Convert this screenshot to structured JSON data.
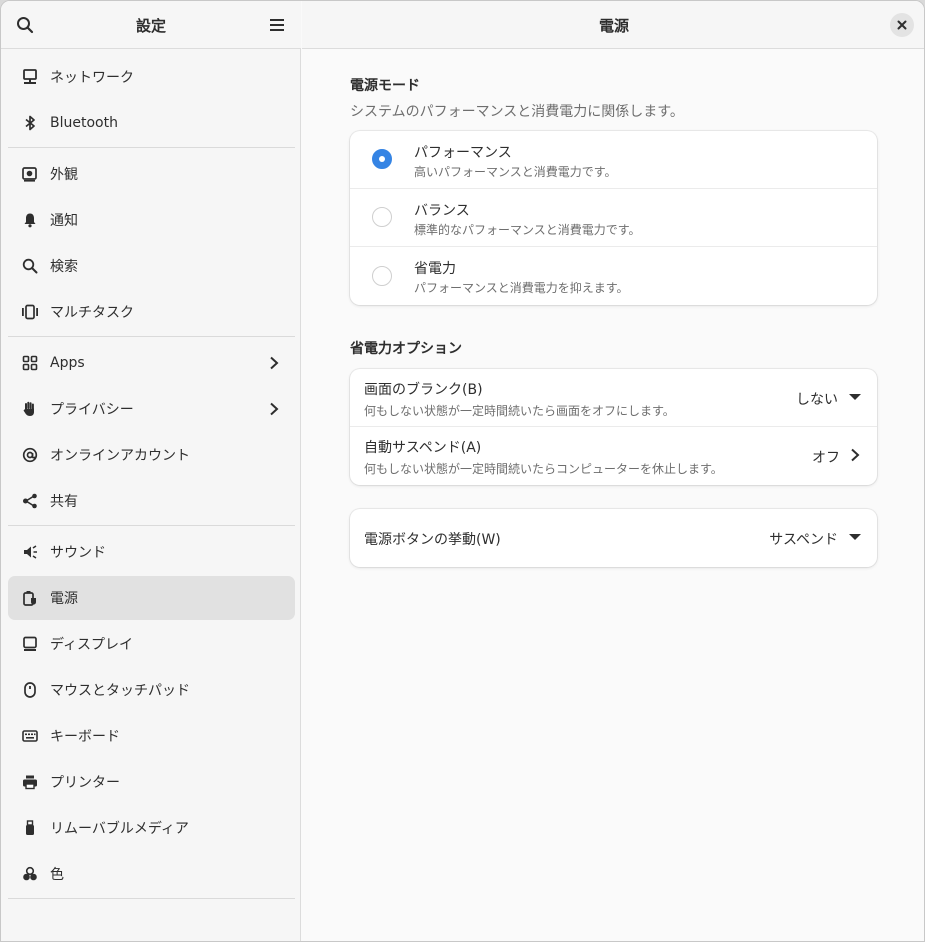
{
  "sidebar": {
    "title": "設定",
    "items": [
      {
        "label": "ネットワーク",
        "icon": "network-wired-icon"
      },
      {
        "label": "Bluetooth",
        "icon": "bluetooth-icon"
      },
      {
        "label": "外観",
        "icon": "appearance-icon"
      },
      {
        "label": "通知",
        "icon": "bell-icon"
      },
      {
        "label": "検索",
        "icon": "search-icon"
      },
      {
        "label": "マルチタスク",
        "icon": "multitasking-icon"
      },
      {
        "label": "Apps",
        "icon": "apps-grid-icon",
        "has_chevron": true
      },
      {
        "label": "プライバシー",
        "icon": "hand-icon",
        "has_chevron": true
      },
      {
        "label": "オンラインアカウント",
        "icon": "at-sign-icon"
      },
      {
        "label": "共有",
        "icon": "share-icon"
      },
      {
        "label": "サウンド",
        "icon": "speaker-icon"
      },
      {
        "label": "電源",
        "icon": "power-icon",
        "active": true
      },
      {
        "label": "ディスプレイ",
        "icon": "display-icon"
      },
      {
        "label": "マウスとタッチパッド",
        "icon": "mouse-icon"
      },
      {
        "label": "キーボード",
        "icon": "keyboard-icon"
      },
      {
        "label": "プリンター",
        "icon": "printer-icon"
      },
      {
        "label": "リムーバブルメディア",
        "icon": "usb-drive-icon"
      },
      {
        "label": "色",
        "icon": "color-icon"
      }
    ]
  },
  "main": {
    "title": "電源",
    "power_mode": {
      "title": "電源モード",
      "subtitle": "システムのパフォーマンスと消費電力に関係します。",
      "options": [
        {
          "title": "パフォーマンス",
          "subtitle": "高いパフォーマンスと消費電力です。",
          "selected": true
        },
        {
          "title": "バランス",
          "subtitle": "標準的なパフォーマンスと消費電力です。",
          "selected": false
        },
        {
          "title": "省電力",
          "subtitle": "パフォーマンスと消費電力を抑えます。",
          "selected": false
        }
      ]
    },
    "power_saving": {
      "title": "省電力オプション",
      "rows": [
        {
          "title": "画面のブランク(B)",
          "subtitle": "何もしない状態が一定時間続いたら画面をオフにします。",
          "value": "しない",
          "control": "dropdown"
        },
        {
          "title": "自動サスペンド(A)",
          "subtitle": "何もしない状態が一定時間続いたらコンピューターを休止します。",
          "value": "オフ",
          "control": "chevron"
        }
      ]
    },
    "power_button": {
      "title": "電源ボタンの挙動(W)",
      "value": "サスペンド",
      "control": "dropdown"
    }
  },
  "colors": {
    "accent": "#3584e4",
    "sidebar_bg": "#f6f6f6",
    "active_item_bg": "#e1e1e1"
  }
}
